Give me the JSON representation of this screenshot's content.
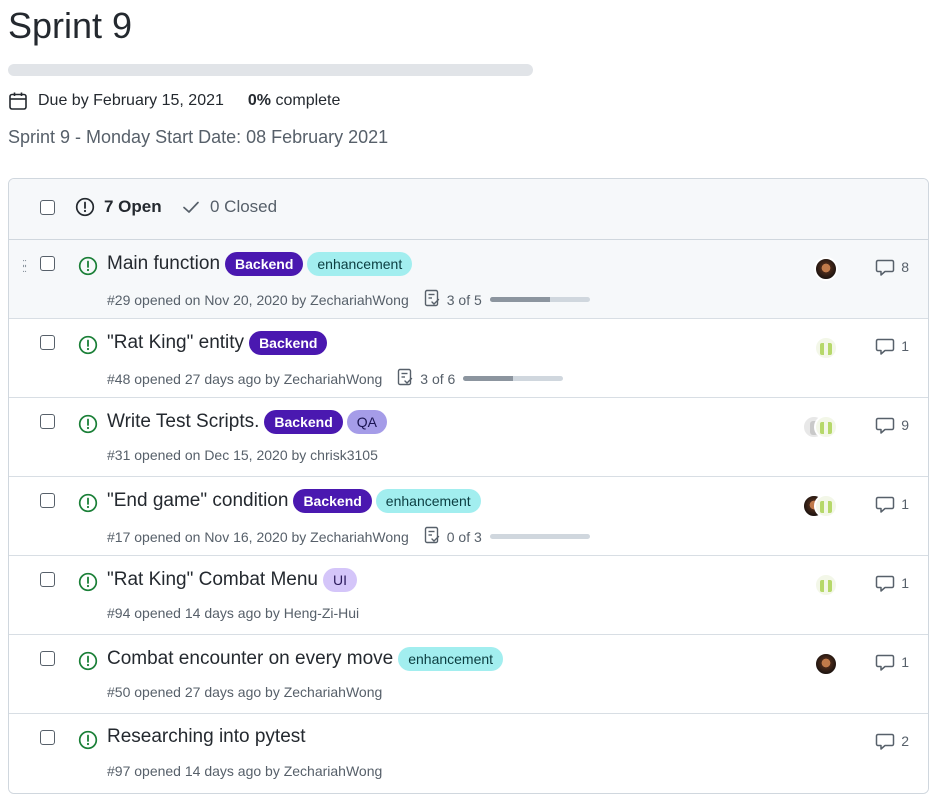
{
  "milestone": {
    "title": "Sprint 9",
    "progress_fraction": 0.0,
    "due_label": "Due by February 15, 2021",
    "percent_value": "0%",
    "percent_suffix": " complete",
    "description": "Sprint 9 - Monday Start Date: 08 February 2021"
  },
  "filters": {
    "open_label": "7 Open",
    "closed_label": "0 Closed"
  },
  "colors": {
    "backend": "#4a18b0",
    "enhancement": "#a2eeef",
    "qa": "#a59ce8",
    "ui": "#d4c5f9",
    "open_icon": "#1a7f37"
  },
  "issues": [
    {
      "title": "Main function",
      "labels": [
        {
          "name": "Backend",
          "kind": "backend"
        },
        {
          "name": "enhancement",
          "kind": "enhancement"
        }
      ],
      "meta": "#29 opened on Nov 20, 2020 by ZechariahWong",
      "tasks": "3 of 5",
      "tasks_done": 3,
      "tasks_total": 5,
      "avatars": [
        "dark"
      ],
      "comments": "8"
    },
    {
      "title": "\"Rat King\" entity",
      "labels": [
        {
          "name": "Backend",
          "kind": "backend"
        }
      ],
      "meta": "#48 opened 27 days ago by ZechariahWong",
      "tasks": "3 of 6",
      "tasks_done": 3,
      "tasks_total": 6,
      "avatars": [
        "green"
      ],
      "comments": "1"
    },
    {
      "title": "Write Test Scripts.",
      "labels": [
        {
          "name": "Backend",
          "kind": "backend"
        },
        {
          "name": "QA",
          "kind": "qa"
        }
      ],
      "meta": "#31 opened on Dec 15, 2020 by chrisk3105",
      "avatars": [
        "grey",
        "green"
      ],
      "comments": "9"
    },
    {
      "title": "\"End game\" condition",
      "labels": [
        {
          "name": "Backend",
          "kind": "backend"
        },
        {
          "name": "enhancement",
          "kind": "enhancement"
        }
      ],
      "meta": "#17 opened on Nov 16, 2020 by ZechariahWong",
      "tasks": "0 of 3",
      "tasks_done": 0,
      "tasks_total": 3,
      "avatars": [
        "dark",
        "green"
      ],
      "comments": "1"
    },
    {
      "title": "\"Rat King\" Combat Menu",
      "labels": [
        {
          "name": "UI",
          "kind": "ui"
        }
      ],
      "meta": "#94 opened 14 days ago by Heng-Zi-Hui",
      "avatars": [
        "green"
      ],
      "comments": "1"
    },
    {
      "title": "Combat encounter on every move",
      "labels": [
        {
          "name": "enhancement",
          "kind": "enhancement"
        }
      ],
      "meta": "#50 opened 27 days ago by ZechariahWong",
      "avatars": [
        "dark"
      ],
      "comments": "1"
    },
    {
      "title": "Researching into pytest",
      "labels": [],
      "meta": "#97 opened 14 days ago by ZechariahWong",
      "avatars": [],
      "comments": "2"
    }
  ]
}
